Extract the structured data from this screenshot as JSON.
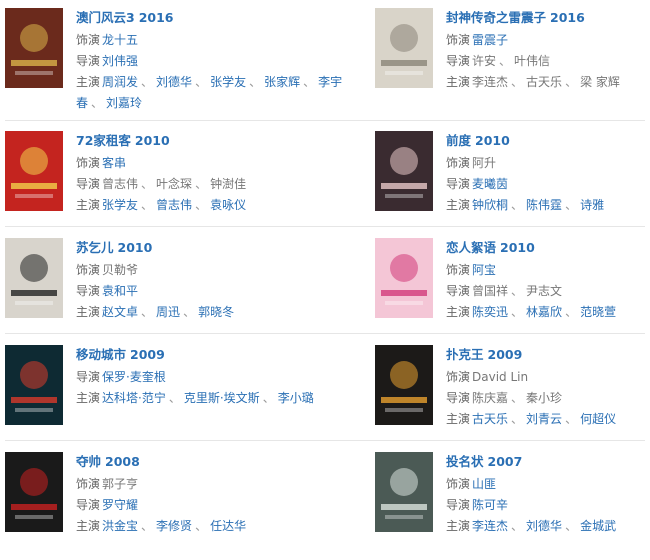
{
  "movies": [
    {
      "title": "澳门风云3",
      "year": "2016",
      "role": {
        "label": "饰演",
        "names": [
          {
            "t": "龙十五",
            "link": true
          }
        ]
      },
      "director": {
        "label": "导演",
        "names": [
          {
            "t": "刘伟强",
            "link": true
          }
        ]
      },
      "cast": {
        "label": "主演",
        "names": [
          {
            "t": "周润发",
            "link": true
          },
          {
            "t": "刘德华",
            "link": true
          },
          {
            "t": "张学友",
            "link": true
          },
          {
            "t": "张家辉",
            "link": true
          },
          {
            "t": "李宇春",
            "link": true
          },
          {
            "t": "刘嘉玲",
            "link": true
          }
        ]
      },
      "poster": {
        "bg": "#6b2a1c",
        "accent": "#d9b24a"
      }
    },
    {
      "title": "封神传奇之雷震子",
      "year": "2016",
      "role": {
        "label": "饰演",
        "names": [
          {
            "t": "雷震子",
            "link": true
          }
        ]
      },
      "director": {
        "label": "导演",
        "names": [
          {
            "t": "许安",
            "link": false
          },
          {
            "t": "叶伟信",
            "link": false
          }
        ]
      },
      "cast": {
        "label": "主演",
        "names": [
          {
            "t": "李连杰",
            "link": false
          },
          {
            "t": "古天乐",
            "link": false
          },
          {
            "t": "梁 家辉",
            "link": false
          }
        ]
      },
      "poster": {
        "bg": "#d9d4c9",
        "accent": "#8a8478"
      }
    },
    {
      "title": "72家租客",
      "year": "2010",
      "role": {
        "label": "饰演",
        "names": [
          {
            "t": "客串",
            "link": true
          }
        ]
      },
      "director": {
        "label": "导演",
        "names": [
          {
            "t": "曾志伟",
            "link": false
          },
          {
            "t": "叶念琛",
            "link": false
          },
          {
            "t": "钟澍佳",
            "link": false
          }
        ]
      },
      "cast": {
        "label": "主演",
        "names": [
          {
            "t": "张学友",
            "link": true
          },
          {
            "t": "曾志伟",
            "link": true
          },
          {
            "t": "袁咏仪",
            "link": true
          }
        ]
      },
      "poster": {
        "bg": "#c4241f",
        "accent": "#f2d04a"
      }
    },
    {
      "title": "前度",
      "year": "2010",
      "role": {
        "label": "饰演",
        "names": [
          {
            "t": "阿升",
            "link": false
          }
        ]
      },
      "director": {
        "label": "导演",
        "names": [
          {
            "t": "麦曦茵",
            "link": true
          }
        ]
      },
      "cast": {
        "label": "主演",
        "names": [
          {
            "t": "钟欣桐",
            "link": true
          },
          {
            "t": "陈伟霆",
            "link": true
          },
          {
            "t": "诗雅",
            "link": true
          }
        ]
      },
      "poster": {
        "bg": "#3a2b30",
        "accent": "#e8c8c8"
      }
    },
    {
      "title": "苏乞儿",
      "year": "2010",
      "role": {
        "label": "饰演",
        "names": [
          {
            "t": "贝勒爷",
            "link": false
          }
        ]
      },
      "director": {
        "label": "导演",
        "names": [
          {
            "t": "袁和平",
            "link": true
          }
        ]
      },
      "cast": {
        "label": "主演",
        "names": [
          {
            "t": "赵文卓",
            "link": true
          },
          {
            "t": "周迅",
            "link": true
          },
          {
            "t": "郭晓冬",
            "link": true
          }
        ]
      },
      "poster": {
        "bg": "#d8d4cc",
        "accent": "#222222"
      }
    },
    {
      "title": "恋人絮语",
      "year": "2010",
      "role": {
        "label": "饰演",
        "names": [
          {
            "t": "阿宝",
            "link": true
          }
        ]
      },
      "director": {
        "label": "导演",
        "names": [
          {
            "t": "曾国祥",
            "link": false
          },
          {
            "t": "尹志文",
            "link": false
          }
        ]
      },
      "cast": {
        "label": "主演",
        "names": [
          {
            "t": "陈奕迅",
            "link": true
          },
          {
            "t": "林嘉欣",
            "link": true
          },
          {
            "t": "范晓萱",
            "link": true
          }
        ]
      },
      "poster": {
        "bg": "#f4c6d6",
        "accent": "#d23a7a"
      }
    },
    {
      "title": "移动城市",
      "year": "2009",
      "director": {
        "label": "导演",
        "names": [
          {
            "t": "保罗·麦奎根",
            "link": true
          }
        ]
      },
      "cast": {
        "label": "主演",
        "names": [
          {
            "t": "达科塔·范宁",
            "link": true
          },
          {
            "t": "克里斯·埃文斯",
            "link": true
          },
          {
            "t": "李小璐",
            "link": true
          }
        ]
      },
      "poster": {
        "bg": "#0e2a33",
        "accent": "#d83a2a"
      }
    },
    {
      "title": "扑克王",
      "year": "2009",
      "role": {
        "label": "饰演",
        "names": [
          {
            "t": "David Lin",
            "link": false
          }
        ]
      },
      "director": {
        "label": "导演",
        "names": [
          {
            "t": "陈庆嘉",
            "link": false
          },
          {
            "t": "秦小珍",
            "link": false
          }
        ]
      },
      "cast": {
        "label": "主演",
        "names": [
          {
            "t": "古天乐",
            "link": true
          },
          {
            "t": "刘青云",
            "link": true
          },
          {
            "t": "何超仪",
            "link": true
          }
        ]
      },
      "poster": {
        "bg": "#1c1a18",
        "accent": "#e8a030"
      }
    },
    {
      "title": "夺帅",
      "year": "2008",
      "role": {
        "label": "饰演",
        "names": [
          {
            "t": "郭子亨",
            "link": false
          }
        ]
      },
      "director": {
        "label": "导演",
        "names": [
          {
            "t": "罗守耀",
            "link": true
          }
        ]
      },
      "cast": {
        "label": "主演",
        "names": [
          {
            "t": "洪金宝",
            "link": true
          },
          {
            "t": "李修贤",
            "link": true
          },
          {
            "t": "任达华",
            "link": true
          }
        ]
      },
      "poster": {
        "bg": "#1a1a1a",
        "accent": "#c82020"
      }
    },
    {
      "title": "投名状",
      "year": "2007",
      "role": {
        "label": "饰演",
        "names": [
          {
            "t": "山匪",
            "link": true
          }
        ]
      },
      "director": {
        "label": "导演",
        "names": [
          {
            "t": "陈可辛",
            "link": true
          }
        ]
      },
      "cast": {
        "label": "主演",
        "names": [
          {
            "t": "李连杰",
            "link": true
          },
          {
            "t": "刘德华",
            "link": true
          },
          {
            "t": "金城武",
            "link": true
          }
        ]
      },
      "poster": {
        "bg": "#4b5a55",
        "accent": "#d9e2dc"
      }
    }
  ]
}
